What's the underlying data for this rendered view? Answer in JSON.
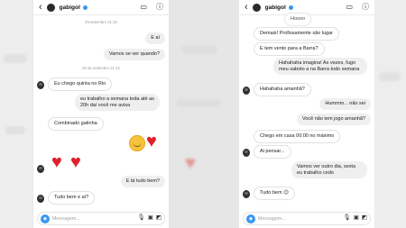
{
  "left": {
    "header": {
      "username": "gabigol"
    },
    "messages": {
      "timestamp_1": "29 setembro 21:15",
      "m1": "E aí",
      "m2": "Vamos se ver quando?",
      "timestamp_2": "30 de setembro 21:22",
      "m3": "Eu chego quinta no Rio",
      "m4": "eu trabalho a semana toda até as 20h daí você me avisa",
      "m5": "Combinado gatinha",
      "m6": "E tá tudo bem?",
      "m7": "Tudo bem e aí?"
    },
    "composer": {
      "placeholder": "Mensagem..."
    }
  },
  "right": {
    "header": {
      "username": "gabigol"
    },
    "messages": {
      "m0": "Hoooo",
      "m1": "Demais! Profissamente são lugar",
      "m2": "E tem vento para a Barra?",
      "m3": "Hahahaha imagina! As vezes, fugo meu saboto a na Barra todo semana",
      "m4": "Hahahaha amanhã?",
      "m5": "Hummm... não sei",
      "m6": "Você não tem jogo amanhã?",
      "m7": "Chego em casa 00:00 no máximo",
      "m8": "Ai pensar...",
      "m9": "Vamos ver outro dia, sexta eu trabalho cedo",
      "m10": "Tudo bem 😉"
    },
    "composer": {
      "placeholder": "Mensagem..."
    }
  },
  "colors": {
    "accent": "#3897f0",
    "heart": "#e0202c",
    "bubble_out": "#efefef"
  },
  "icons": [
    "back-arrow-icon",
    "video-call-icon",
    "info-icon",
    "camera-icon",
    "mic-icon",
    "gallery-icon",
    "sticker-icon",
    "heart-emoji",
    "smile-emoji"
  ]
}
